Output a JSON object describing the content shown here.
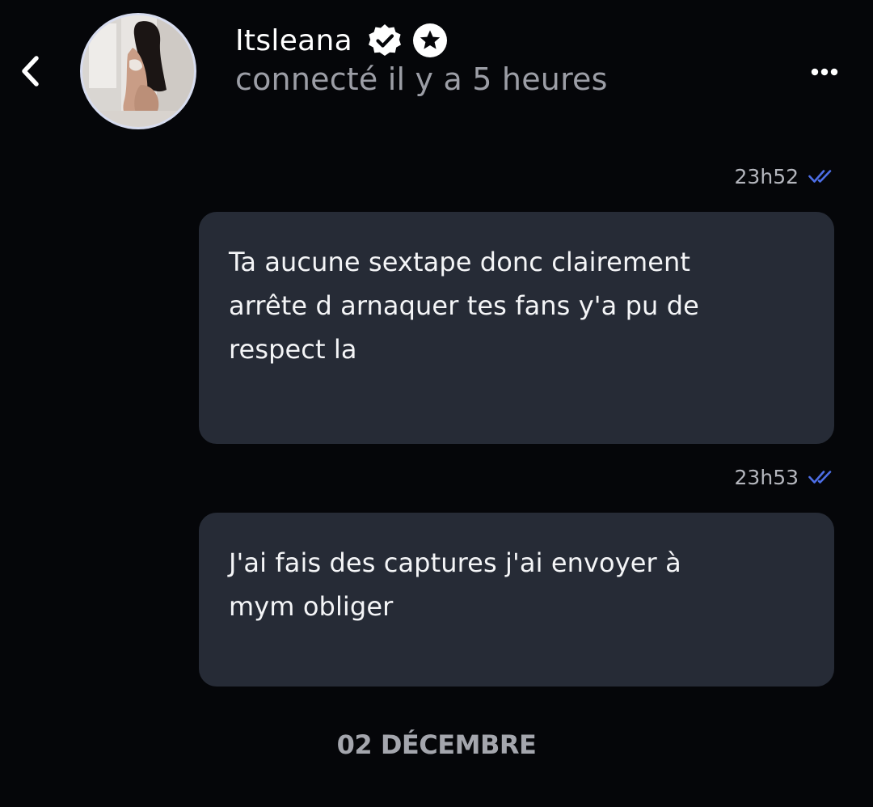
{
  "header": {
    "name": "Itsleana",
    "status": "connecté il y a 5 heures",
    "back_icon": "chevron-left-icon",
    "more_icon": "more-horizontal-icon",
    "verified_icon": "verified-badge-icon",
    "star_icon": "star-badge-icon"
  },
  "messages": [
    {
      "time": "23h52",
      "read": true,
      "lines": [
        "Ta aucune sextape donc clairement",
        "arrête d arnaquer tes fans y'a pu de",
        "respect la"
      ]
    },
    {
      "time": "23h53",
      "read": true,
      "lines": [
        "J'ai fais des captures j'ai envoyer à",
        "mym obliger"
      ]
    }
  ],
  "date_separator": "02 DÉCEMBRE",
  "colors": {
    "background": "#050609",
    "bubble": "#262b36",
    "read_ticks": "#4d6ee6",
    "status_text": "#9c9ea6"
  }
}
